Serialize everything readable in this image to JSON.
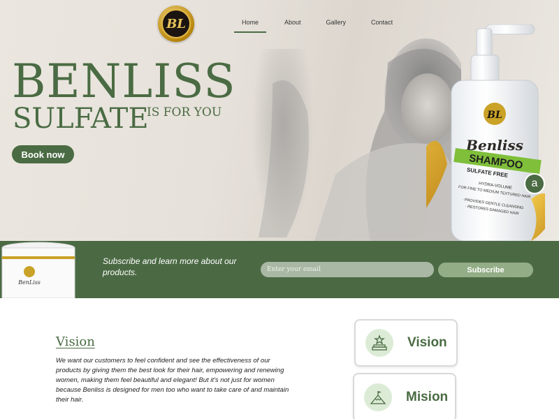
{
  "nav": {
    "logo_text": "BL",
    "items": [
      "Home",
      "About",
      "Gallery",
      "Contact"
    ],
    "active": "Home"
  },
  "hero": {
    "brand": "BENLISS",
    "sub": "SULFATE",
    "tagline": "IS FOR YOU",
    "cta": "Book now"
  },
  "product": {
    "logo": "BL",
    "name": "Benliss",
    "type": "SHAMPOO",
    "free": "SULFATE FREE",
    "line1": "HYDRA-VOLUME",
    "line2": "FOR FINE TO MEDIUM TEXTURED HAIR",
    "bullet1": "· PROVIDES GENTLE CLEANSING",
    "bullet2": "· RESTORES DAMAGED HAIR",
    "badge": "a"
  },
  "subscribe": {
    "text": "Subscribe and learn more about our products.",
    "placeholder": "Enter your email",
    "button": "Subscribe",
    "jar_label": "BenLiss"
  },
  "vision": {
    "title": "Vision",
    "body": "We want our customers to feel confident and see the effectiveness of our products by giving them the best look for their hair, empowering and renewing women, making them feel beautiful and elegant! But it's not just for women because Benliss is designed for men too who want to take care of and maintain their hair."
  },
  "cards": [
    {
      "label": "Vision",
      "icon": "podium-star-icon"
    },
    {
      "label": "Mision",
      "icon": "mountain-flag-icon"
    }
  ],
  "colors": {
    "brand_green": "#4a6b43",
    "band_green": "#4b6a44",
    "gold": "#c9a227"
  }
}
